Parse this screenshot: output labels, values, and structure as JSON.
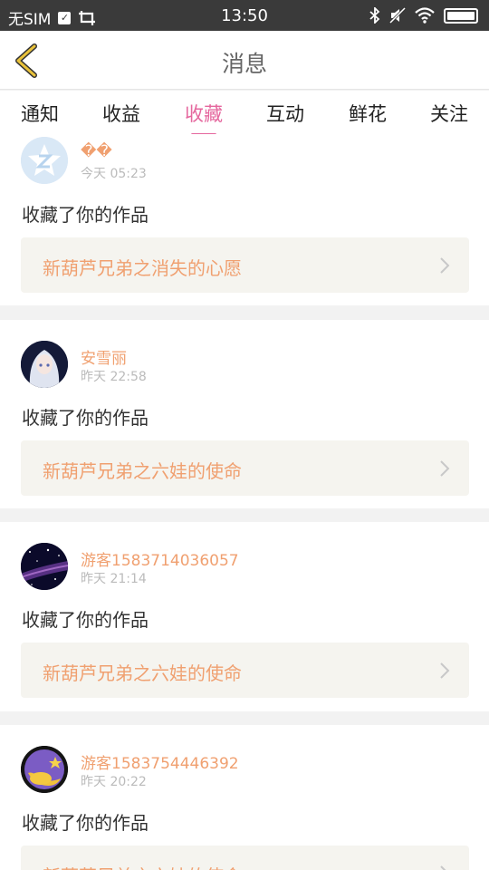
{
  "status_bar": {
    "carrier": "无SIM",
    "time": "13:50"
  },
  "header": {
    "title": "消息"
  },
  "tabs": [
    {
      "label": "通知",
      "active": false
    },
    {
      "label": "收益",
      "active": false
    },
    {
      "label": "收藏",
      "active": true
    },
    {
      "label": "互动",
      "active": false
    },
    {
      "label": "鲜花",
      "active": false
    },
    {
      "label": "关注",
      "active": false
    }
  ],
  "colors": {
    "accent": "#e5679e",
    "username": "#f0a070",
    "card_bg": "#f5f4ef"
  },
  "feed": [
    {
      "username": "��",
      "time": "今天 05:23",
      "action": "收藏了你的作品",
      "work_title": "新葫芦兄弟之消失的心愿",
      "avatar": "default-z-avatar"
    },
    {
      "username": "安雪丽",
      "time": "昨天 22:58",
      "action": "收藏了你的作品",
      "work_title": "新葫芦兄弟之六娃的使命",
      "avatar": "anime-girl-avatar"
    },
    {
      "username": "游客1583714036057",
      "time": "昨天 21:14",
      "action": "收藏了你的作品",
      "work_title": "新葫芦兄弟之六娃的使命",
      "avatar": "starry-sky-avatar"
    },
    {
      "username": "游客1583754446392",
      "time": "昨天 20:22",
      "action": "收藏了你的作品",
      "work_title": "新葫芦兄弟之六娃的使命",
      "avatar": "moon-star-avatar"
    }
  ]
}
